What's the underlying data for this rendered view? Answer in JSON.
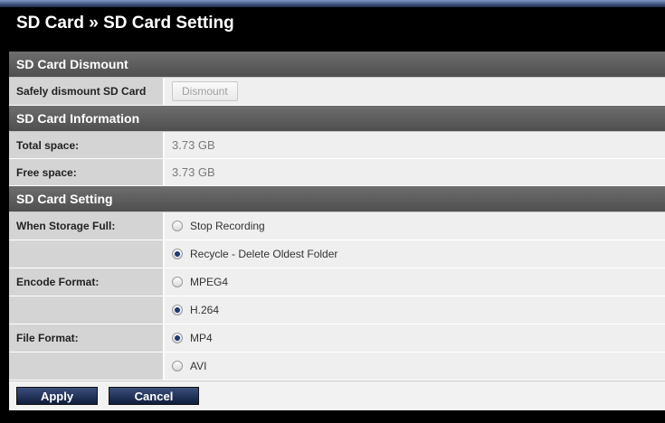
{
  "page": {
    "title": "SD Card » SD Card Setting"
  },
  "sections": {
    "dismount": {
      "header": "SD Card Dismount",
      "row_label": "Safely dismount SD Card",
      "button_label": "Dismount"
    },
    "information": {
      "header": "SD Card Information",
      "total_label": "Total space:",
      "total_value": "3.73 GB",
      "free_label": "Free space:",
      "free_value": "3.73 GB"
    },
    "setting": {
      "header": "SD Card Setting",
      "storage_label": "When Storage Full:",
      "storage_options": [
        "Stop Recording",
        "Recycle - Delete Oldest Folder"
      ],
      "storage_selected": "Recycle - Delete Oldest Folder",
      "encode_label": "Encode Format:",
      "encode_options": [
        "MPEG4",
        "H.264"
      ],
      "encode_selected": "H.264",
      "file_label": "File Format:",
      "file_options": [
        "MP4",
        "AVI"
      ],
      "file_selected": "MP4"
    }
  },
  "footer": {
    "apply_label": "Apply",
    "cancel_label": "Cancel"
  },
  "colors": {
    "section_bg": "#5f5f5f",
    "label_bg": "#d4d4d4",
    "value_bg": "#efefef",
    "button_bg": "#1d2c52"
  }
}
